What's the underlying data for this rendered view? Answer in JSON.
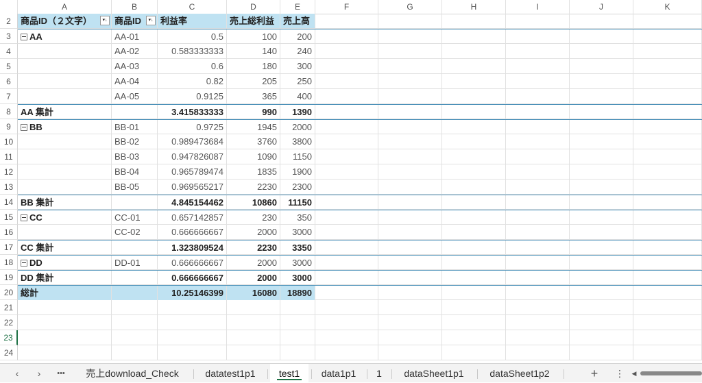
{
  "columns": [
    "A",
    "B",
    "C",
    "D",
    "E",
    "F",
    "G",
    "H",
    "I",
    "J",
    "K"
  ],
  "row_numbers": [
    "2",
    "3",
    "4",
    "5",
    "6",
    "7",
    "8",
    "9",
    "10",
    "11",
    "12",
    "13",
    "14",
    "15",
    "16",
    "17",
    "18",
    "19",
    "20",
    "21",
    "22",
    "23",
    "24"
  ],
  "header": {
    "a": "商品ID（２文字）",
    "b": "商品ID",
    "c": "利益率",
    "d": "売上総利益",
    "e": "売上高"
  },
  "rows": [
    {
      "a": "AA",
      "b": "AA-01",
      "c": "0.5",
      "d": "100",
      "e": "200",
      "kind": "group"
    },
    {
      "a": "",
      "b": "AA-02",
      "c": "0.583333333",
      "d": "140",
      "e": "240",
      "kind": "item"
    },
    {
      "a": "",
      "b": "AA-03",
      "c": "0.6",
      "d": "180",
      "e": "300",
      "kind": "item"
    },
    {
      "a": "",
      "b": "AA-04",
      "c": "0.82",
      "d": "205",
      "e": "250",
      "kind": "item"
    },
    {
      "a": "",
      "b": "AA-05",
      "c": "0.9125",
      "d": "365",
      "e": "400",
      "kind": "item"
    },
    {
      "a": "AA 集計",
      "b": "",
      "c": "3.415833333",
      "d": "990",
      "e": "1390",
      "kind": "sub"
    },
    {
      "a": "BB",
      "b": "BB-01",
      "c": "0.9725",
      "d": "1945",
      "e": "2000",
      "kind": "group"
    },
    {
      "a": "",
      "b": "BB-02",
      "c": "0.989473684",
      "d": "3760",
      "e": "3800",
      "kind": "item"
    },
    {
      "a": "",
      "b": "BB-03",
      "c": "0.947826087",
      "d": "1090",
      "e": "1150",
      "kind": "item"
    },
    {
      "a": "",
      "b": "BB-04",
      "c": "0.965789474",
      "d": "1835",
      "e": "1900",
      "kind": "item"
    },
    {
      "a": "",
      "b": "BB-05",
      "c": "0.969565217",
      "d": "2230",
      "e": "2300",
      "kind": "item"
    },
    {
      "a": "BB 集計",
      "b": "",
      "c": "4.845154462",
      "d": "10860",
      "e": "11150",
      "kind": "sub"
    },
    {
      "a": "CC",
      "b": "CC-01",
      "c": "0.657142857",
      "d": "230",
      "e": "350",
      "kind": "group"
    },
    {
      "a": "",
      "b": "CC-02",
      "c": "0.666666667",
      "d": "2000",
      "e": "3000",
      "kind": "item"
    },
    {
      "a": "CC 集計",
      "b": "",
      "c": "1.323809524",
      "d": "2230",
      "e": "3350",
      "kind": "sub"
    },
    {
      "a": "DD",
      "b": "DD-01",
      "c": "0.666666667",
      "d": "2000",
      "e": "3000",
      "kind": "group"
    },
    {
      "a": "DD 集計",
      "b": "",
      "c": "0.666666667",
      "d": "2000",
      "e": "3000",
      "kind": "sub"
    },
    {
      "a": "総計",
      "b": "",
      "c": "10.25146399",
      "d": "16080",
      "e": "18890",
      "kind": "total"
    }
  ],
  "tabs": {
    "ellipsis": "•••",
    "t1": "売上download_Check",
    "t2": "datatest1p1",
    "t3": "test1",
    "t4": "data1p1",
    "t5": "1",
    "t6": "dataSheet1p1",
    "t7": "dataSheet1p2",
    "add": "+",
    "menu": "⋮"
  },
  "colors": {
    "header_fill": "#bfe2f2",
    "active_tab_underline": "#1e7145"
  }
}
